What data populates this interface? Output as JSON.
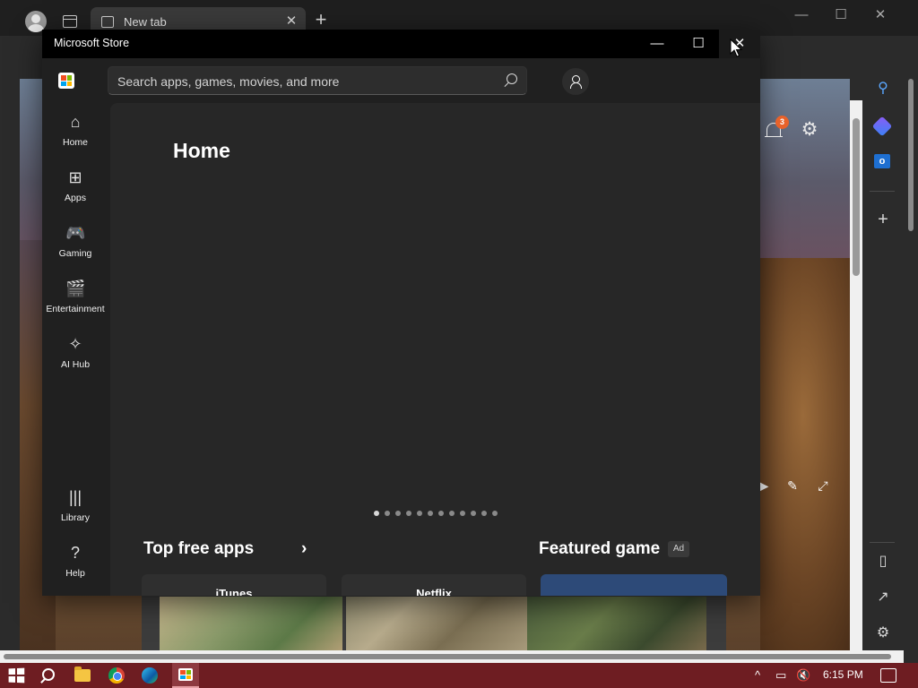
{
  "browser": {
    "tab_title": "New tab",
    "tab_close": "✕",
    "new_tab": "+",
    "minimize": "—",
    "maximize": "☐",
    "close": "✕",
    "toolbar": {
      "favorites_icon": "⊞",
      "health_icon": "♡",
      "more_icon": "···"
    },
    "newtab_controls": [
      "▶",
      "✎",
      "⤢"
    ],
    "sidebar": {
      "add_icon": "+",
      "split_icon": "▯",
      "share_icon": "↗",
      "settings_icon": "⚙"
    }
  },
  "store": {
    "window_title": "Microsoft Store",
    "window_buttons": {
      "minimize": "—",
      "maximize": "☐",
      "close": "✕"
    },
    "search": {
      "placeholder": "Search apps, games, movies, and more"
    },
    "nav": [
      {
        "label": "Home",
        "icon": "home-icon"
      },
      {
        "label": "Apps",
        "icon": "apps-icon"
      },
      {
        "label": "Gaming",
        "icon": "gamepad-icon"
      },
      {
        "label": "Entertainment",
        "icon": "clapperboard-icon"
      },
      {
        "label": "AI Hub",
        "icon": "sparkle-icon"
      },
      {
        "label": "Library",
        "icon": "library-icon"
      },
      {
        "label": "Help",
        "icon": "help-icon"
      }
    ],
    "page_title": "Home",
    "notifications_count": "3",
    "carousel": {
      "slides": 12,
      "active_index": 0
    },
    "sections": {
      "top_free_apps": {
        "title": "Top free apps",
        "chevron": "›"
      },
      "featured_game": {
        "title": "Featured game",
        "badge": "Ad"
      }
    },
    "app_cards": [
      "iTunes",
      "Netflix"
    ]
  },
  "taskbar": {
    "time": "6:15 PM",
    "tray": {
      "chevron": "^",
      "network": "▭",
      "volume": "🔇"
    }
  },
  "colors": {
    "store_bg": "#202020",
    "store_content_bg": "#272727",
    "titlebar": "#000000",
    "taskbar": "#6e1d22",
    "notification_badge": "#e8622a"
  }
}
